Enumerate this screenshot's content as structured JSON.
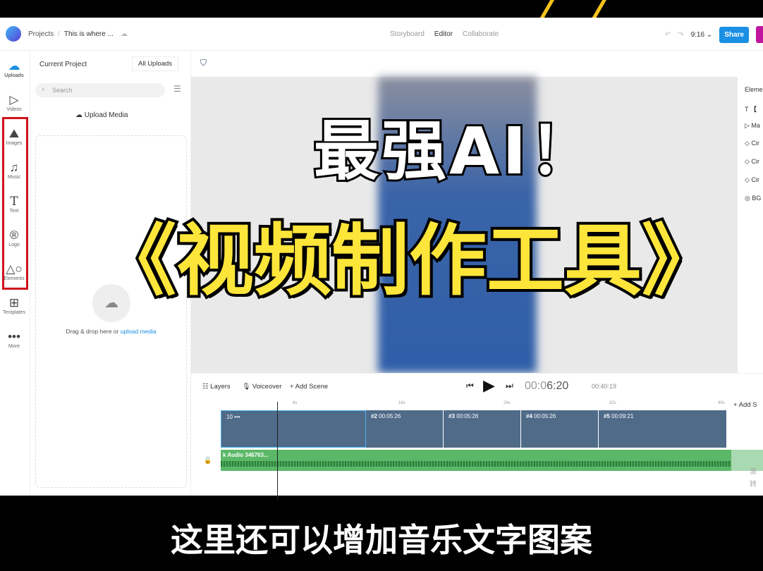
{
  "header": {
    "breadcrumb": [
      "Projects",
      "This is where ..."
    ],
    "tabs": [
      "Storyboard",
      "Editor",
      "Collaborate"
    ],
    "active_tab": "Editor",
    "aspect": "9:16",
    "share_label": "Share"
  },
  "rail": [
    {
      "label": "Uploads",
      "icon": "cloud-upload-icon"
    },
    {
      "label": "Videos",
      "icon": "video-icon"
    },
    {
      "label": "Images",
      "icon": "image-icon"
    },
    {
      "label": "Music",
      "icon": "music-icon"
    },
    {
      "label": "Text",
      "icon": "text-icon"
    },
    {
      "label": "Logo",
      "icon": "logo-icon"
    },
    {
      "label": "Elements",
      "icon": "shapes-icon"
    },
    {
      "label": "Templates",
      "icon": "templates-icon"
    },
    {
      "label": "More",
      "icon": "more-icon"
    }
  ],
  "panel": {
    "current_project": "Current Project",
    "all_uploads": "All Uploads",
    "search_placeholder": "Search",
    "upload_media": "Upload Media",
    "drop_text": "Drag & drop here or ",
    "drop_link": "upload media"
  },
  "right_panel": {
    "title": "Eleme",
    "items": [
      "【",
      "Ma",
      "Cir",
      "Cir",
      "Cir",
      "BG"
    ]
  },
  "timeline": {
    "layers": "Layers",
    "voiceover": "Voiceover",
    "add_scene": "Add Scene",
    "current_time_dim": "00:0",
    "current_time": "6:20",
    "total_time": "00:40:19",
    "ticks": [
      "8s",
      "16s",
      "24s",
      "32s",
      "40s"
    ],
    "add_scene_right": "Add S",
    "scenes": [
      {
        "label": "10",
        "extra": "•••"
      },
      {
        "label": "#2",
        "dur": "00:05:26"
      },
      {
        "label": "#3",
        "dur": "00:05:26"
      },
      {
        "label": "#4",
        "dur": "00:05:26"
      },
      {
        "label": "#5",
        "dur": "00:09:21"
      }
    ],
    "audio_label": "k Audio 346763...",
    "side_text": [
      "激",
      "转"
    ]
  },
  "overlay": {
    "title1": "最强AI！",
    "title2": "《视频制作工具》",
    "subtitle": "这里还可以增加音乐文字图案"
  },
  "colors": {
    "share": "#1a8fe3",
    "highlight_box": "#d0121b",
    "title2": "#fde53a",
    "scene": "#4f6b88",
    "audio": "#5bb868"
  }
}
